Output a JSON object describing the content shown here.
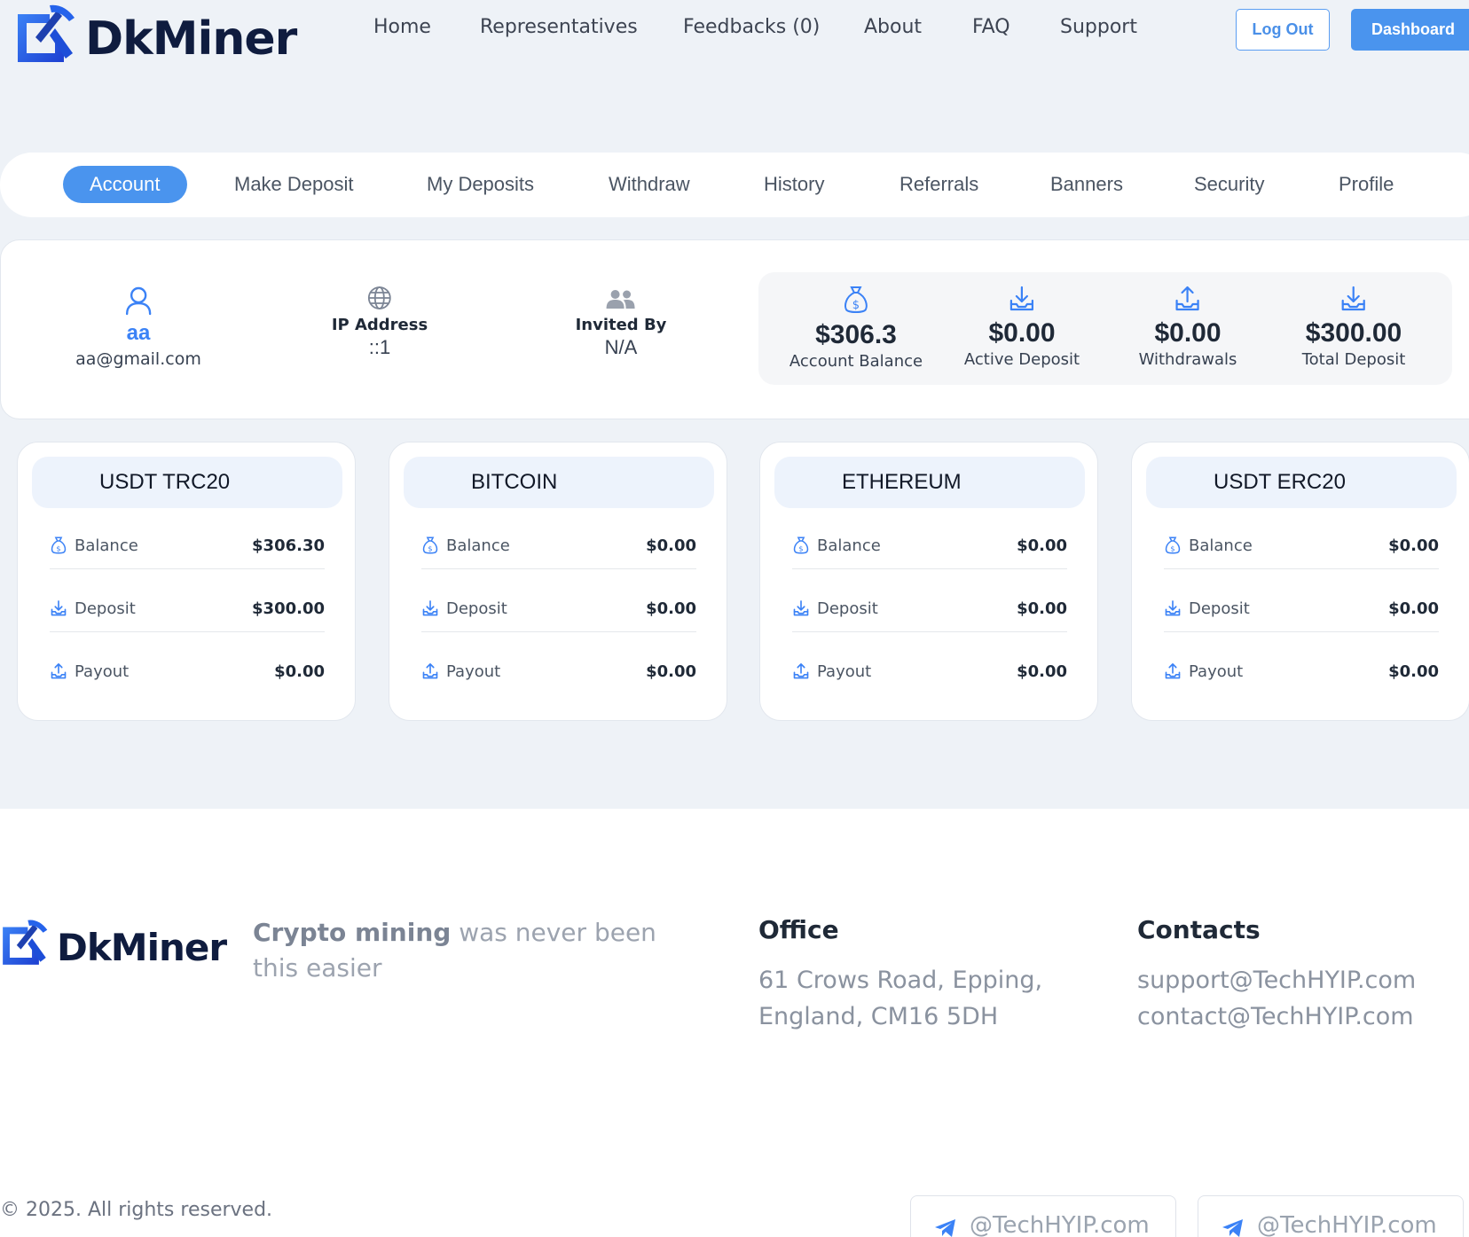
{
  "brand": {
    "name": "DkMiner"
  },
  "nav": {
    "items": [
      "Home",
      "Representatives",
      "Feedbacks (0)",
      "About",
      "FAQ",
      "Support"
    ],
    "logout_label": "Log Out",
    "dashboard_label": "Dashboard"
  },
  "tabs": [
    "Account",
    "Make Deposit",
    "My Deposits",
    "Withdraw",
    "History",
    "Referrals",
    "Banners",
    "Security",
    "Profile"
  ],
  "active_tab": "Account",
  "user": {
    "name": "aa",
    "email": "aa@gmail.com"
  },
  "ip": {
    "label": "IP Address",
    "value": "::1"
  },
  "invited": {
    "label": "Invited By",
    "value": "N/A"
  },
  "stats": [
    {
      "value": "$306.3",
      "label": "Account Balance",
      "icon": "money-bag-icon"
    },
    {
      "value": "$0.00",
      "label": "Active Deposit",
      "icon": "download-tray-icon"
    },
    {
      "value": "$0.00",
      "label": "Withdrawals",
      "icon": "upload-tray-icon"
    },
    {
      "value": "$300.00",
      "label": "Total Deposit",
      "icon": "download-tray-icon"
    }
  ],
  "wallets": [
    {
      "name": "USDT TRC20",
      "balance": "$306.30",
      "deposit": "$300.00",
      "payout": "$0.00"
    },
    {
      "name": "BITCOIN",
      "balance": "$0.00",
      "deposit": "$0.00",
      "payout": "$0.00"
    },
    {
      "name": "ETHEREUM",
      "balance": "$0.00",
      "deposit": "$0.00",
      "payout": "$0.00"
    },
    {
      "name": "USDT ERC20",
      "balance": "$0.00",
      "deposit": "$0.00",
      "payout": "$0.00"
    }
  ],
  "wallet_labels": {
    "balance": "Balance",
    "deposit": "Deposit",
    "payout": "Payout"
  },
  "footer": {
    "tagline_strong": "Crypto mining",
    "tagline_rest": " was never been this easier",
    "office_title": "Office",
    "office_lines": [
      "61 Crows Road, Epping,",
      "England, CM16 5DH"
    ],
    "contacts_title": "Contacts",
    "contacts_lines": [
      "support@TechHYIP.com",
      "contact@TechHYIP.com"
    ],
    "copyright": "© 2025. All rights reserved.",
    "telegram": [
      "@TechHYIP.com",
      "@TechHYIP.com"
    ]
  },
  "colors": {
    "accent": "#4a94ee",
    "page_bg": "#eef2f7",
    "brand_dark": "#0f1c3f"
  }
}
